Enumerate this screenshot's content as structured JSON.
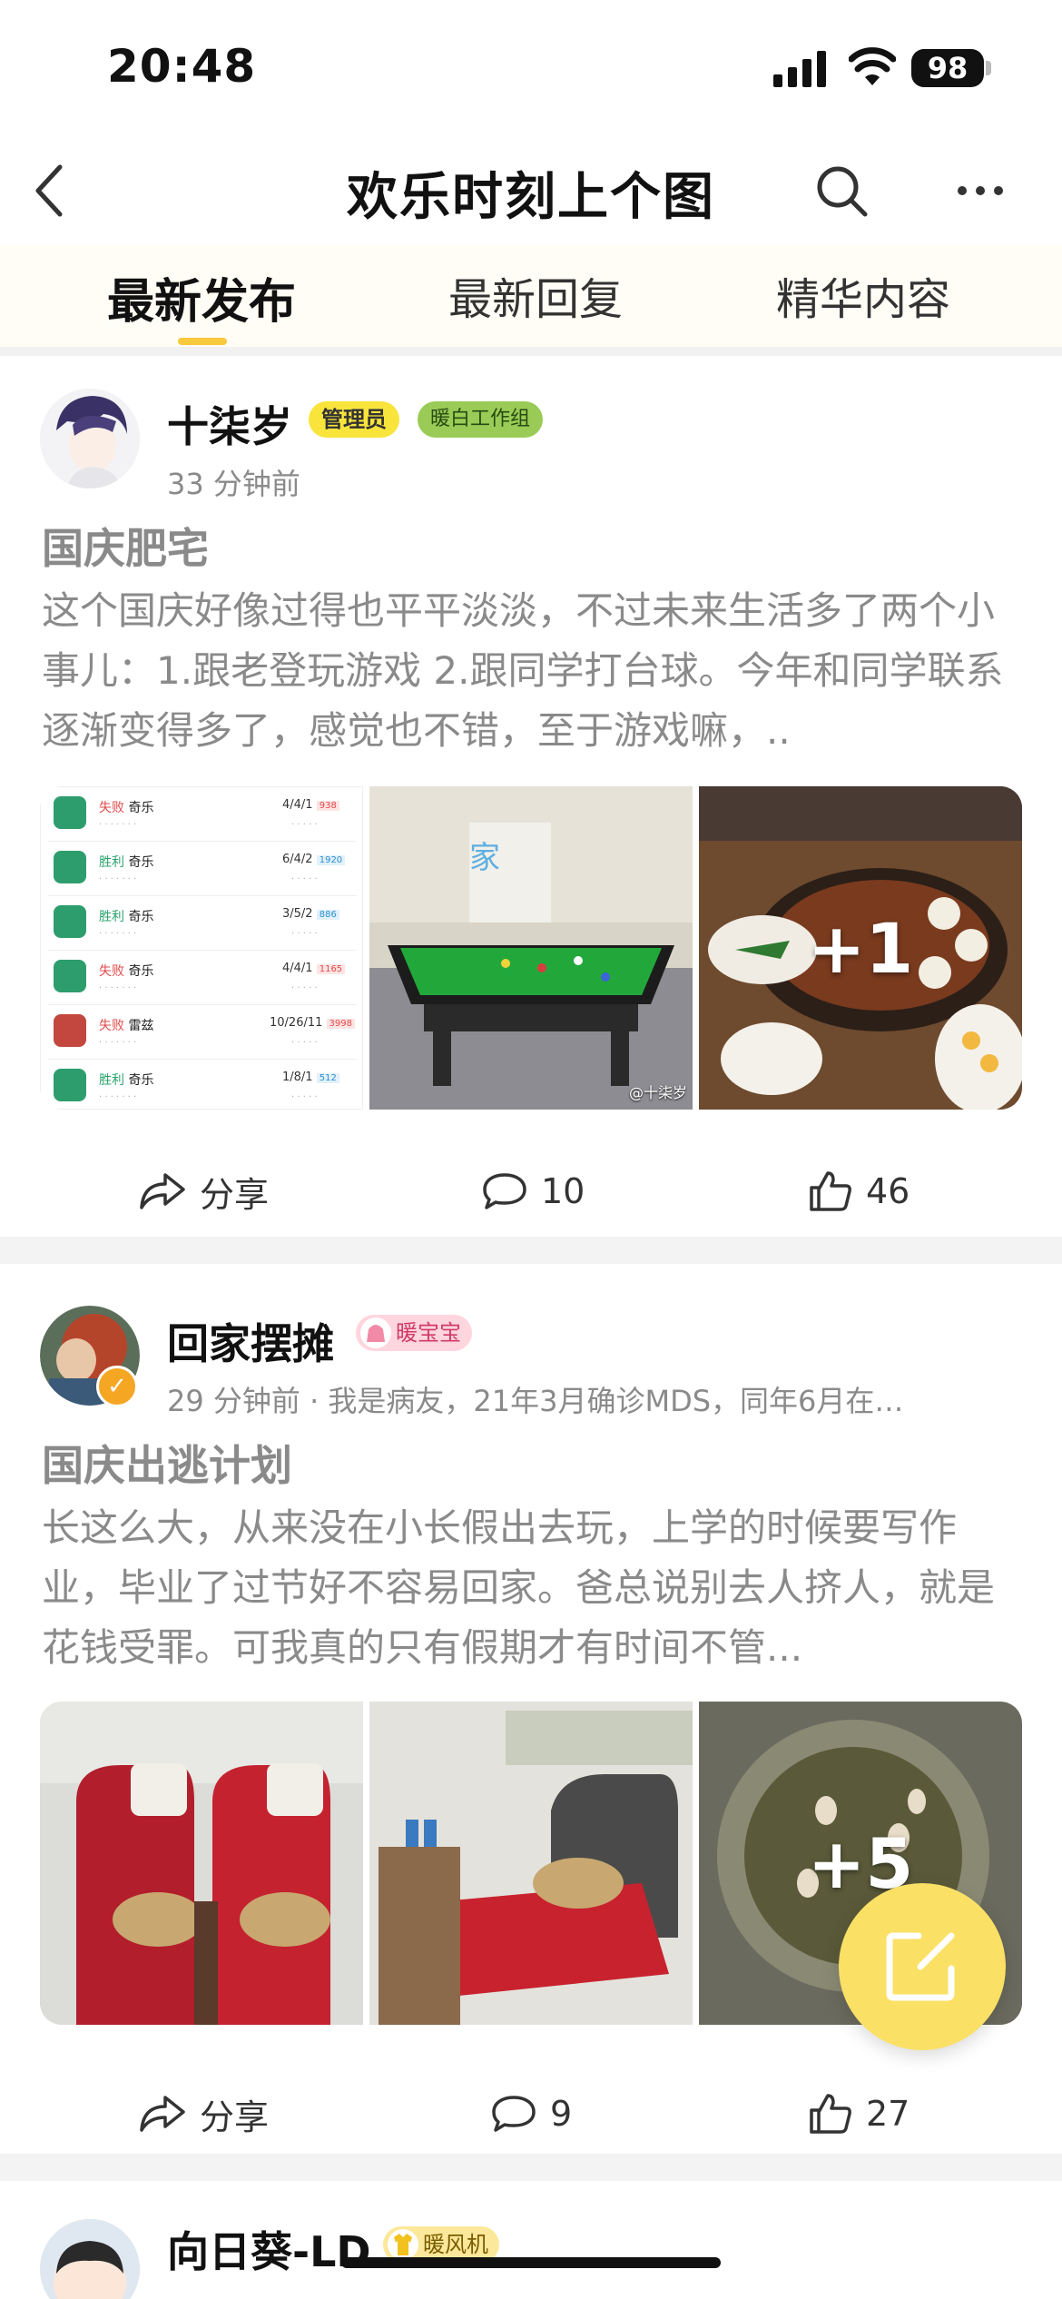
{
  "status_bar": {
    "time": "20:48",
    "battery": "98"
  },
  "nav": {
    "title": "欢乐时刻上个图"
  },
  "tabs": [
    {
      "label": "最新发布",
      "active": true
    },
    {
      "label": "最新回复",
      "active": false
    },
    {
      "label": "精华内容",
      "active": false
    }
  ],
  "posts": [
    {
      "username": "十柒岁",
      "badges": [
        "管理员",
        "暖白工作组"
      ],
      "meta": "33 分钟前",
      "title": "国庆肥宅",
      "body": "这个国庆好像过得也平平淡淡，不过未来生活多了两个小事儿：1.跟老登玩游戏 2.跟同学打台球。今年和同学联系逐渐变得多了，感觉也不错，至于游戏嘛，..",
      "extra_images": "+1",
      "image_watermark": "@十柒岁",
      "game_records": [
        {
          "result": "失败",
          "name": "奇乐",
          "score": "4/4/1",
          "points": "938"
        },
        {
          "result": "胜利",
          "name": "奇乐",
          "score": "6/4/2",
          "points": "1920"
        },
        {
          "result": "胜利",
          "name": "奇乐",
          "score": "3/5/2",
          "points": "886"
        },
        {
          "result": "失败",
          "name": "奇乐",
          "score": "4/4/1",
          "points": "1165"
        },
        {
          "result": "失败",
          "name": "雷兹",
          "score": "10/26/11",
          "points": "3998"
        },
        {
          "result": "胜利",
          "name": "奇乐",
          "score": "1/8/1",
          "points": "512"
        }
      ],
      "actions": {
        "share": "分享",
        "comments": "10",
        "likes": "46"
      }
    },
    {
      "username": "回家摆摊",
      "badges": [
        "暖宝宝"
      ],
      "meta": "29 分钟前 · 我是病友，21年3月确诊MDS，同年6月在…",
      "title": "国庆出逃计划",
      "body": "长这么大，从来没在小长假出去玩，上学的时候要写作业，毕业了过节好不容易回家。爸总说别去人挤人，就是花钱受罪。可我真的只有假期才有时间不管...",
      "extra_images": "+5",
      "actions": {
        "share": "分享",
        "comments": "9",
        "likes": "27"
      }
    },
    {
      "username": "向日葵-LD",
      "badges": [
        "暖风机"
      ]
    }
  ],
  "colors": {
    "accent": "#f7c93c",
    "fab": "#fae065",
    "admin_badge": "#f9e43c",
    "group_badge": "#9acb57"
  }
}
